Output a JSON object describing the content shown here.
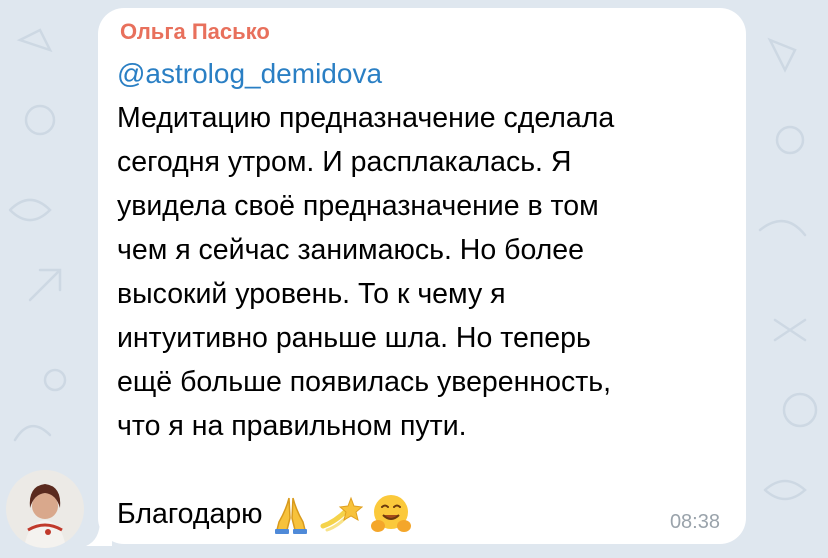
{
  "message": {
    "sender_name": "Ольга Пасько",
    "mention": "@astrolog_demidova",
    "lines": [
      "Медитацию предназначение сделала",
      "сегодня утром. И расплакалась. Я",
      "увидела своё предназначение в том",
      "чем я сейчас занимаюсь. Но более",
      "высокий уровень. То к чему я",
      "интуитивно раньше шла. Но теперь",
      "ещё больше появилась уверенность,",
      "что я на правильном пути."
    ],
    "closing_text": "Благодарю",
    "emojis": [
      "folded-hands",
      "dizzy",
      "hugging-face"
    ],
    "time": "08:38"
  },
  "colors": {
    "chat_background": "#dfe7ef",
    "bubble": "#ffffff",
    "sender_name": "#e8705c",
    "mention": "#2a7fc4",
    "timestamp": "#9aa3ab"
  }
}
